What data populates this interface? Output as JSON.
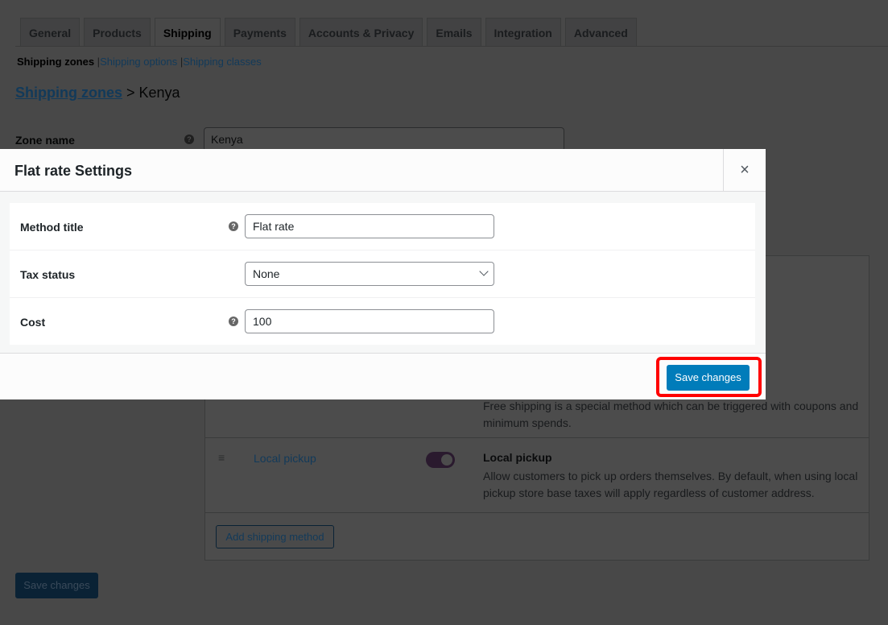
{
  "tabs": [
    "General",
    "Products",
    "Shipping",
    "Payments",
    "Accounts & Privacy",
    "Emails",
    "Integration",
    "Advanced"
  ],
  "active_tab": "Shipping",
  "subnav": {
    "current": "Shipping zones",
    "links": [
      "Shipping options",
      "Shipping classes"
    ]
  },
  "breadcrumb": {
    "link": "Shipping zones",
    "separator": " > ",
    "current": "Kenya"
  },
  "zone": {
    "label": "Zone name",
    "value": "Kenya"
  },
  "methods": {
    "free_shipping_desc": "Free shipping is a special method which can be triggered with coupons and minimum spends.",
    "local_pickup": {
      "name": "Local pickup",
      "enabled": true,
      "title": "Local pickup",
      "desc": "Allow customers to pick up orders themselves. By default, when using local pickup store base taxes will apply regardless of customer address."
    },
    "add_button": "Add shipping method"
  },
  "page_save": "Save changes",
  "modal": {
    "title": "Flat rate Settings",
    "close": "×",
    "fields": [
      {
        "label": "Method title",
        "value": "Flat rate"
      },
      {
        "label": "Tax status",
        "value": "None"
      },
      {
        "label": "Cost",
        "value": "100"
      }
    ],
    "save": "Save changes"
  },
  "colors": {
    "accent": "#2271b1",
    "highlight": "#ff0000"
  }
}
